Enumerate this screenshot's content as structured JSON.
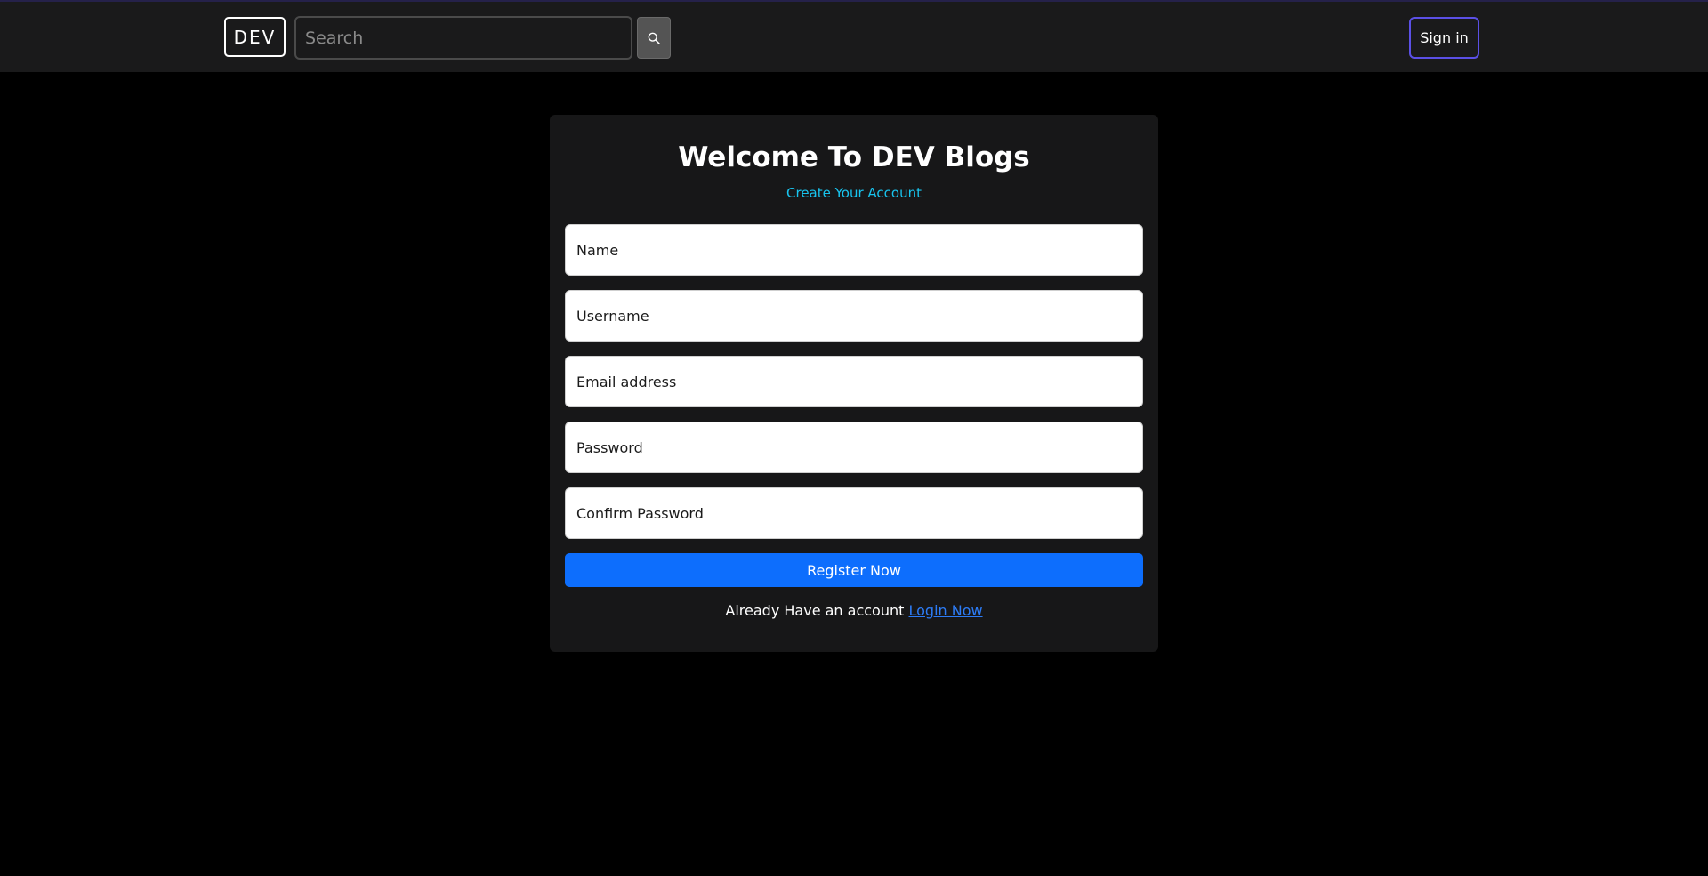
{
  "header": {
    "logo": "DEV",
    "search": {
      "placeholder": "Search",
      "value": ""
    },
    "search_button_icon": "search-icon",
    "signin_label": "Sign in"
  },
  "form": {
    "title": "Welcome To DEV Blogs",
    "subtitle": "Create Your Account",
    "fields": [
      {
        "placeholder": "Name",
        "value": ""
      },
      {
        "placeholder": "Username",
        "value": ""
      },
      {
        "placeholder": "Email address",
        "value": ""
      },
      {
        "placeholder": "Password",
        "value": ""
      },
      {
        "placeholder": "Confirm Password",
        "value": ""
      }
    ],
    "submit_label": "Register Now",
    "login_prompt": "Already Have an account",
    "login_link": "Login Now"
  },
  "colors": {
    "page_bg": "#000000",
    "header_bg": "#1a1a1b",
    "card_bg": "#171718",
    "subtitle": "#18c4ee",
    "primary": "#0d6efd",
    "signin_border": "#5b50e6",
    "link": "#2d7cf6"
  }
}
